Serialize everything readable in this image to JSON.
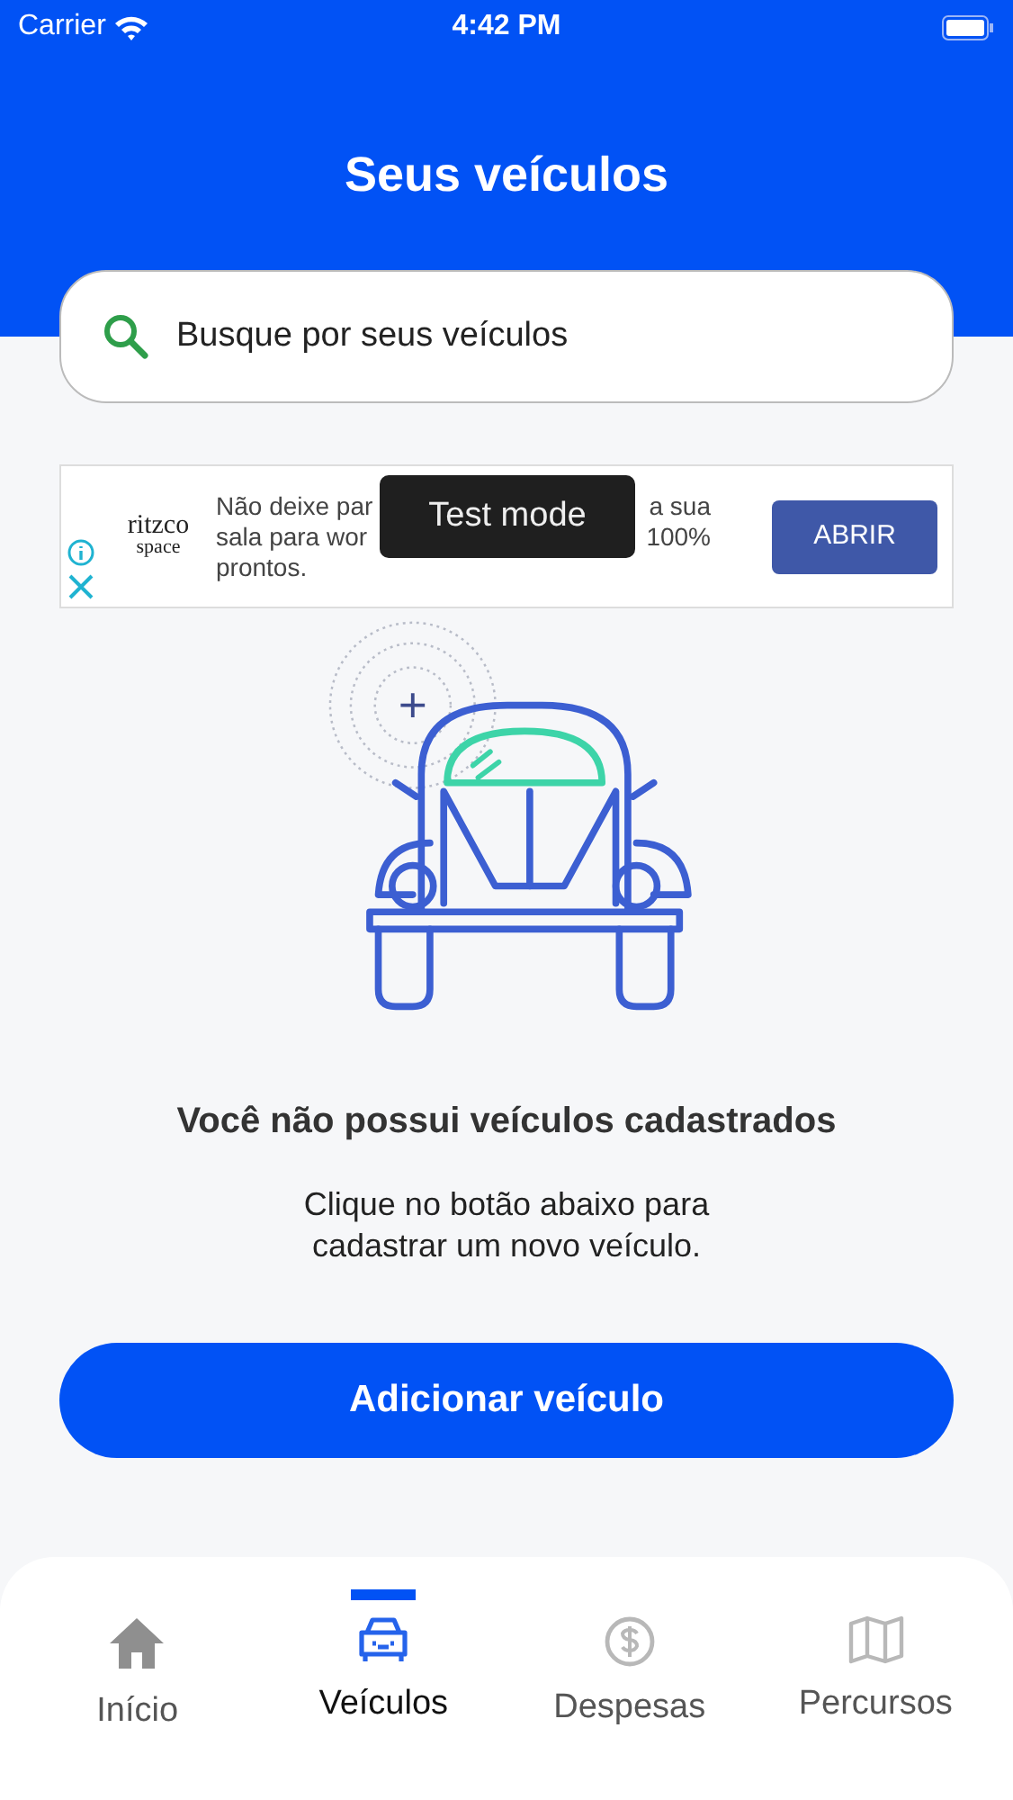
{
  "status_bar": {
    "carrier": "Carrier",
    "time": "4:42 PM"
  },
  "header": {
    "title": "Seus veículos"
  },
  "search": {
    "placeholder": "Busque por seus veículos"
  },
  "ad": {
    "logo_top": "ritzco",
    "logo_bottom": "space",
    "text_lines": [
      [
        "Não deixe par",
        "a sua"
      ],
      [
        "sala para wor",
        "100%"
      ],
      [
        "prontos."
      ]
    ],
    "button": "ABRIR",
    "toast": "Test mode"
  },
  "empty_state": {
    "title": "Você não possui veículos cadastrados",
    "message": "Clique no botão abaixo para cadastrar um novo veículo.",
    "button": "Adicionar veículo"
  },
  "tabs": [
    {
      "kind": "home",
      "label": "Início",
      "selected": false
    },
    {
      "kind": "car",
      "label": "Veículos",
      "selected": true
    },
    {
      "kind": "money",
      "label": "Despesas",
      "selected": false
    },
    {
      "kind": "map",
      "label": "Percursos",
      "selected": false
    }
  ]
}
